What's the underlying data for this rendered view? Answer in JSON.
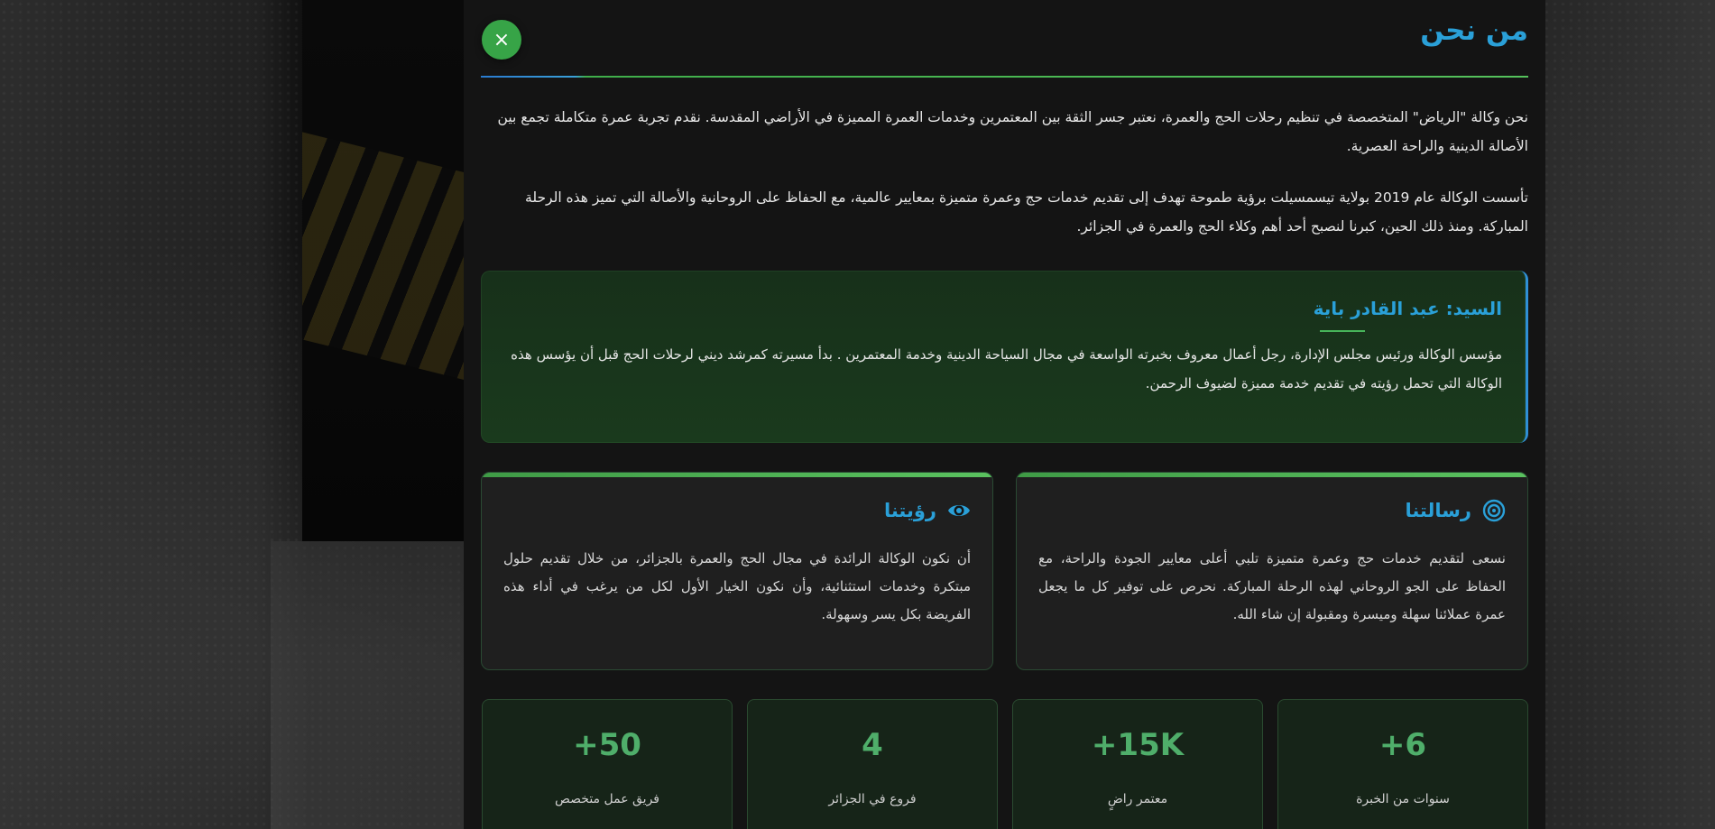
{
  "modal": {
    "title": "من نحن",
    "close_icon": "×",
    "paragraphs": [
      "نحن وكالة \"الرياض\" المتخصصة في تنظيم رحلات الحج والعمرة، نعتبر جسر الثقة بين المعتمرين وخدمات العمرة المميزة في الأراضي المقدسة. نقدم تجربة عمرة متكاملة تجمع بين الأصالة الدينية والراحة العصرية.",
      "تأسست الوكالة عام 2019 بولاية تيسمسيلت برؤية طموحة تهدف إلى تقديم خدمات حج وعمرة متميزة بمعايير عالمية، مع الحفاظ على الروحانية والأصالة التي تميز هذه الرحلة المباركة. ومنذ ذلك الحين، كبرنا لنصبح أحد أهم وكلاء الحج والعمرة في الجزائر."
    ],
    "founder": {
      "name": "السيد: عبد القادر باية",
      "bio": "مؤسس الوكالة ورئيس مجلس الإدارة، رجل أعمال معروف بخبرته الواسعة في مجال السياحة الدينية وخدمة المعتمرين . بدأ مسيرته كمرشد ديني لرحلات الحج قبل أن يؤسس هذه الوكالة التي تحمل رؤيته في تقديم خدمة مميزة لضيوف الرحمن."
    },
    "mission": {
      "icon": "target-icon",
      "title": "رسالتنا",
      "text": "نسعى لتقديم خدمات حج وعمرة متميزة تلبي أعلى معايير الجودة والراحة، مع الحفاظ على الجو الروحاني لهذه الرحلة المباركة. نحرص على توفير كل ما يجعل عمرة عملائنا سهلة وميسرة ومقبولة إن شاء الله."
    },
    "vision": {
      "icon": "eye-icon",
      "title": "رؤيتنا",
      "text": "أن نكون الوكالة الرائدة في مجال الحج والعمرة بالجزائر، من خلال تقديم حلول مبتكرة وخدمات استثنائية، وأن نكون الخيار الأول لكل من يرغب في أداء هذه الفريضة بكل يسر وسهولة."
    },
    "stats": [
      {
        "value": "+6",
        "label": "سنوات من الخبرة"
      },
      {
        "value": "+15K",
        "label": "معتمر راضٍ"
      },
      {
        "value": "4",
        "label": "فروع في الجزائر"
      },
      {
        "value": "+50",
        "label": "فريق عمل متخصص"
      }
    ]
  },
  "colors": {
    "accent_blue": "#2aa0d8",
    "accent_green": "#37a447",
    "stat_green": "#4fae6a"
  }
}
